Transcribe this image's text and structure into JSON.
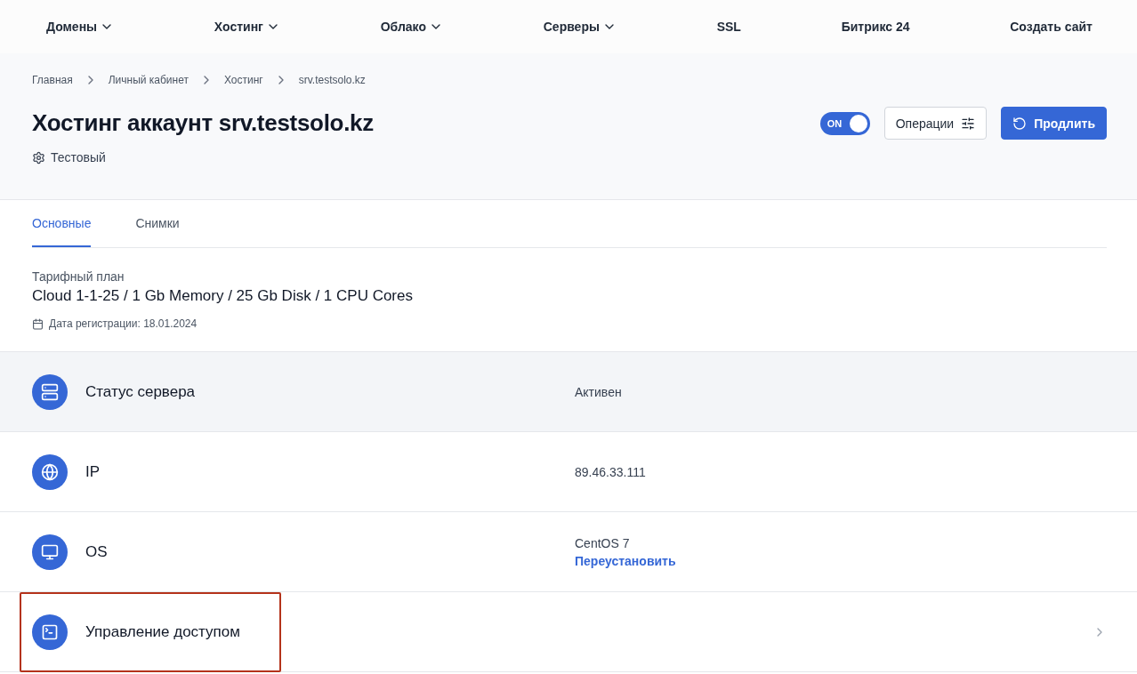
{
  "nav": [
    {
      "label": "Домены",
      "dropdown": true
    },
    {
      "label": "Хостинг",
      "dropdown": true
    },
    {
      "label": "Облако",
      "dropdown": true
    },
    {
      "label": "Серверы",
      "dropdown": true
    },
    {
      "label": "SSL",
      "dropdown": false
    },
    {
      "label": "Битрикс 24",
      "dropdown": false
    },
    {
      "label": "Создать сайт",
      "dropdown": false
    }
  ],
  "breadcrumbs": [
    "Главная",
    "Личный кабинет",
    "Хостинг",
    "srv.testsolo.kz"
  ],
  "page_title": "Хостинг аккаунт srv.testsolo.kz",
  "subtitle": "Тестовый",
  "toggle": {
    "label": "ON",
    "on": true
  },
  "buttons": [
    {
      "label": "Операции",
      "kind": "secondary"
    },
    {
      "label": "Продлить",
      "kind": "primary"
    }
  ],
  "tabs": [
    {
      "label": "Основные",
      "selected": true
    },
    {
      "label": "Снимки",
      "selected": false
    }
  ],
  "plan": {
    "label": "Тарифный план",
    "value": "Cloud 1-1-25 / 1 Gb Memory / 25 Gb Disk / 1 CPU Cores",
    "date": "Дата регистрации: 18.01.2024"
  },
  "rows": [
    {
      "kind": "status",
      "label": "Статус сервера",
      "value": "Активен",
      "shaded": true,
      "highlighted": false
    },
    {
      "kind": "ip",
      "label": "IP",
      "value": "89.46.33.111",
      "shaded": false,
      "highlighted": false
    },
    {
      "kind": "os",
      "label": "OS",
      "value": "CentOS 7",
      "link": "Переустановить",
      "shaded": false,
      "highlighted": false
    },
    {
      "kind": "access",
      "label": "Управление доступом",
      "shaded": false,
      "highlighted": true
    }
  ]
}
